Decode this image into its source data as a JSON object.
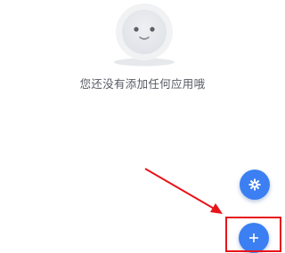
{
  "empty_state": {
    "illustration": "smiley-face-icon",
    "message": "您还没有添加任何应用哦"
  },
  "fab_settings": {
    "icon": "gear-icon",
    "color": "#3b7ff2"
  },
  "fab_add": {
    "icon": "plus-icon",
    "color": "#3b7ff2"
  },
  "annotation": {
    "arrow_color": "#e8141a",
    "box_color": "#e8141a"
  }
}
